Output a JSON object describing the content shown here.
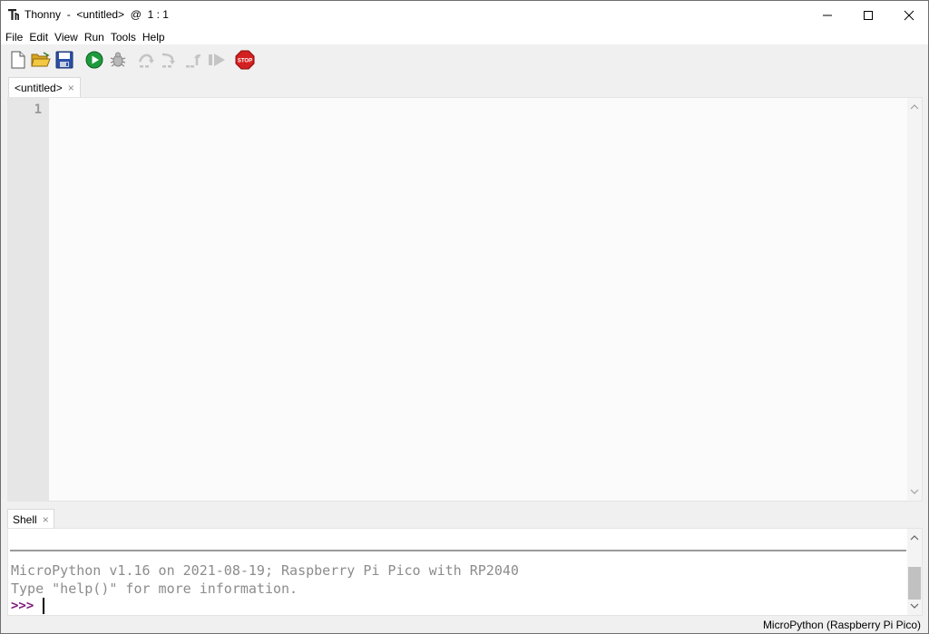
{
  "window": {
    "title": "Thonny  -  <untitled>  @  1 : 1"
  },
  "menu": {
    "items": [
      {
        "label": "File"
      },
      {
        "label": "Edit"
      },
      {
        "label": "View"
      },
      {
        "label": "Run"
      },
      {
        "label": "Tools"
      },
      {
        "label": "Help"
      }
    ]
  },
  "toolbar": {
    "buttons": [
      {
        "icon": "new-file-icon"
      },
      {
        "icon": "open-folder-icon"
      },
      {
        "icon": "save-icon"
      },
      {
        "icon": "run-icon"
      },
      {
        "icon": "debug-icon"
      },
      {
        "icon": "step-over-icon"
      },
      {
        "icon": "step-into-icon"
      },
      {
        "icon": "step-out-icon"
      },
      {
        "icon": "resume-icon"
      },
      {
        "icon": "stop-icon"
      }
    ],
    "stop_label": "STOP"
  },
  "editor": {
    "tab_label": "<untitled>",
    "tab_close": "×",
    "line_numbers": [
      "1"
    ]
  },
  "shell": {
    "tab_label": "Shell",
    "tab_close": "×",
    "output_lines": [
      "MicroPython v1.16 on 2021-08-19; Raspberry Pi Pico with RP2040",
      "Type \"help()\" for more information."
    ],
    "prompt": ">>>"
  },
  "status": {
    "interpreter": "MicroPython (Raspberry Pi Pico)"
  },
  "colors": {
    "prompt": "#7b1a7b",
    "run": "#1e9a3c",
    "stop": "#d32020"
  }
}
